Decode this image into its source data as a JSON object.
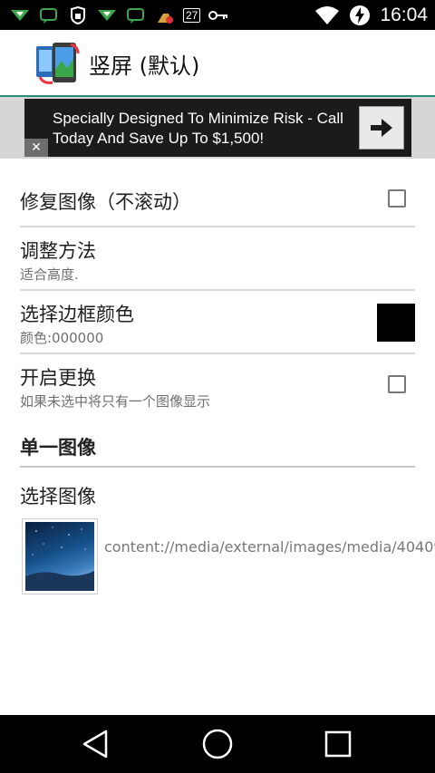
{
  "status_bar": {
    "time": "16:04",
    "badge": "27",
    "icons": [
      "signal-download-icon",
      "chat-icon",
      "lock-icon",
      "signal-download-icon",
      "chat-icon",
      "cleaner-icon",
      "battery-27-icon",
      "key-icon",
      "wifi-icon",
      "battery-charging-icon"
    ]
  },
  "app_bar": {
    "title": "竖屏 (默认)"
  },
  "ad": {
    "text": "Specially Designed To Minimize Risk - Call Today And Save Up To $1,500!",
    "close": "✕"
  },
  "prefs": {
    "fix_image": {
      "title": "修复图像（不滚动）"
    },
    "adjust_method": {
      "title": "调整方法",
      "summary": "适合高度."
    },
    "border_color": {
      "title": "选择边框颜色",
      "summary": "颜色:000000",
      "color": "#000000"
    },
    "enable_switch": {
      "title": "开启更换",
      "summary": "如果未选中将只有一个图像显示"
    }
  },
  "section": {
    "title": "单一图像"
  },
  "select_image": {
    "title": "选择图像",
    "uri": "content://media/external/images/media/40409"
  },
  "nav": {
    "buttons": [
      "back-icon",
      "home-icon",
      "recents-icon"
    ]
  },
  "colors": {
    "accent": "#2a8c7e",
    "status_bar": "#000000",
    "ad_background": "#1b1b1b"
  }
}
